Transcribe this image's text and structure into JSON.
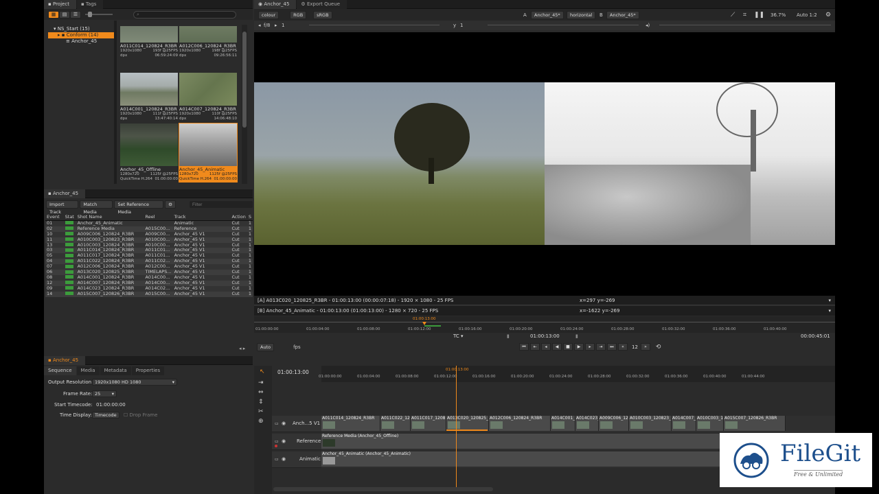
{
  "project_panel": {
    "tabs": [
      "Project",
      "Tags"
    ],
    "tree": [
      {
        "label": "NS_Start (15)"
      },
      {
        "label": "Conform (14)"
      },
      {
        "label": "Anchor_45"
      }
    ],
    "thumbnails": [
      {
        "name": "A011C014_120824_R3BR",
        "res": "1920x1080",
        "frames": "193f @25FPS",
        "fmt": "dpx",
        "tc": "06:59:24:09"
      },
      {
        "name": "A012C006_120824_R3BR",
        "res": "1920x1080",
        "frames": "198f @25FPS",
        "fmt": "dpx",
        "tc": "09:26:56:11"
      },
      {
        "name": "A014C001_120824_R3BR",
        "res": "1920x1080",
        "frames": "111f @25FPS",
        "fmt": "dpx",
        "tc": "13:47:40:14"
      },
      {
        "name": "A014C007_120824_R3BR",
        "res": "1920x1080",
        "frames": "110f @25FPS",
        "fmt": "dpx",
        "tc": "14:06:48:10"
      },
      {
        "name": "Anchor_45_Offline",
        "res": "1280x720",
        "frames": "1125f @25FPS",
        "fmt": "QuickTime H.264",
        "tc": "01:00:00:00"
      },
      {
        "name": "Anchor_45_Animatic",
        "res": "1280x720",
        "frames": "1125f @25FPS",
        "fmt": "QuickTime H.264",
        "tc": "01:00:00:00"
      }
    ]
  },
  "event_panel": {
    "tab": "Anchor_45",
    "buttons": [
      "Import Track",
      "Match Media",
      "Set Reference Media"
    ],
    "filter_placeholder": "Filter",
    "columns": [
      "Event",
      "Stat",
      "Shot Name",
      "Reel",
      "Track",
      "Action",
      "S"
    ],
    "rows": [
      [
        "01",
        "",
        "Anchor_45_Animatic",
        "",
        "Animatic",
        "Cut",
        "1"
      ],
      [
        "02",
        "",
        "Reference Media",
        "A015C00...",
        "Reference",
        "Cut",
        "1"
      ],
      [
        "10",
        "",
        "A009C006_120824_R3BR",
        "A009C00...",
        "Anchor_45 V1",
        "Cut",
        "1"
      ],
      [
        "11",
        "",
        "A010C003_120823_R3BR",
        "A010C00...",
        "Anchor_45 V1",
        "Cut",
        "1"
      ],
      [
        "13",
        "",
        "A010C003_120824_R3BR",
        "A010C00...",
        "Anchor_45 V1",
        "Cut",
        "1"
      ],
      [
        "03",
        "",
        "A011C014_120824_R3BR",
        "A011C01...",
        "Anchor_45 V1",
        "Cut",
        "1"
      ],
      [
        "05",
        "",
        "A011C017_120824_R3BR",
        "A011C01...",
        "Anchor_45 V1",
        "Cut",
        "1"
      ],
      [
        "04",
        "",
        "A011C022_120824_R3BR",
        "A011C02...",
        "Anchor_45 V1",
        "Cut",
        "1"
      ],
      [
        "07",
        "",
        "A012C006_120824_R3BR",
        "A012C00...",
        "Anchor_45 V1",
        "Cut",
        "1"
      ],
      [
        "06",
        "",
        "A013C020_120825_R3BR",
        "TIMELAPS...",
        "Anchor_45 V1",
        "Cut",
        "1"
      ],
      [
        "08",
        "",
        "A014C001_120824_R3BR",
        "A014C00...",
        "Anchor_45 V1",
        "Cut",
        "1"
      ],
      [
        "12",
        "",
        "A014C007_120824_R3BR",
        "A014C00...",
        "Anchor_45 V1",
        "Cut",
        "1"
      ],
      [
        "09",
        "",
        "A014C023_120824_R3BR",
        "A014C02...",
        "Anchor_45 V1",
        "Cut",
        "1"
      ],
      [
        "14",
        "",
        "A015C007_120826_R3BR",
        "A015C00...",
        "Anchor_45 V1",
        "Cut",
        "1"
      ]
    ]
  },
  "viewer": {
    "tabs": [
      "Anchor_45",
      "Export Queue"
    ],
    "toolbar": {
      "colour": "colour",
      "rgb": "RGB",
      "srgb": "sRGB",
      "a_label": "A",
      "a_value": "Anchor_45*",
      "mode": "horizontal",
      "b_label": "B",
      "b_value": "Anchor_45*",
      "zoom": "36.7%",
      "scale": "Auto 1:2"
    },
    "toolbar2": {
      "fstop": "f/8",
      "fval": "1",
      "y_label": "y",
      "y_val": "1"
    },
    "info_a": "[A] A013C020_120825_R3BR - 01:00:13:00 (00:00:07:18) - 1920 × 1080 - 25 FPS",
    "coords_a": "x=297 y=-269",
    "info_b": "[B] Anchor_45_Animatic - 01:00:13:00 (01:00:13:00) - 1280 × 720 - 25 FPS",
    "coords_b": "x=-1622 y=-269",
    "playhead_tc": "01:00:13:00",
    "ruler": [
      "01:00:00:00",
      "01:00:04:00",
      "01:00:08:00",
      "01:00:12:00",
      "01:00:16:00",
      "01:00:20:00",
      "01:00:24:00",
      "01:00:28:00",
      "01:00:32:00",
      "01:00:36:00",
      "01:00:40:00"
    ],
    "tc_label": "TC",
    "current_tc": "01:00:13:00",
    "duration": "00:00:45:01",
    "auto": "Auto",
    "fps": "fps",
    "step": "12"
  },
  "properties": {
    "tab": "Anchor_45",
    "subtabs": [
      "Sequence",
      "Media",
      "Metadata",
      "Properties"
    ],
    "output_resolution_label": "Output Resolution:",
    "output_resolution": "1920x1080 HD 1080",
    "frame_rate_label": "Frame Rate:",
    "frame_rate": "25",
    "start_tc_label": "Start Timecode:",
    "start_tc": "01:00:00:00",
    "time_display_label": "Time Display:",
    "time_display": "Timecode",
    "drop_frame": "Drop Frame"
  },
  "timeline": {
    "current_tc": "01:00:13:00",
    "playhead": "01:00:13:00",
    "ruler": [
      "01:00:00:00",
      "01:00:04:00",
      "01:00:08:00",
      "01:00:12:00",
      "01:00:16:00",
      "01:00:20:00",
      "01:00:24:00",
      "01:00:28:00",
      "01:00:32:00",
      "01:00:36:00",
      "01:00:40:00",
      "01:00:44:00"
    ],
    "tracks": [
      "Anch...5 V1",
      "Reference",
      "Animatic"
    ],
    "v1_clips": [
      "A011C014_120824_R3BR",
      "A011C022_12",
      "A011C017_1208",
      "A013C020_120825_",
      "A012C006_120824_R3BR",
      "A014C001_",
      "A014C023_",
      "A009C006_12",
      "A010C003_120823_",
      "A014C007_",
      "A010C003_1",
      "A015C007_120826_R3BR"
    ],
    "reference_clip": "Reference Media (Anchor_45_Offline)",
    "animatic_clip": "Anchor_45_Animatic (Anchor_45_Animatic)"
  },
  "watermark": {
    "brand": "FileGit",
    "tagline": "Free & Unlimited"
  }
}
